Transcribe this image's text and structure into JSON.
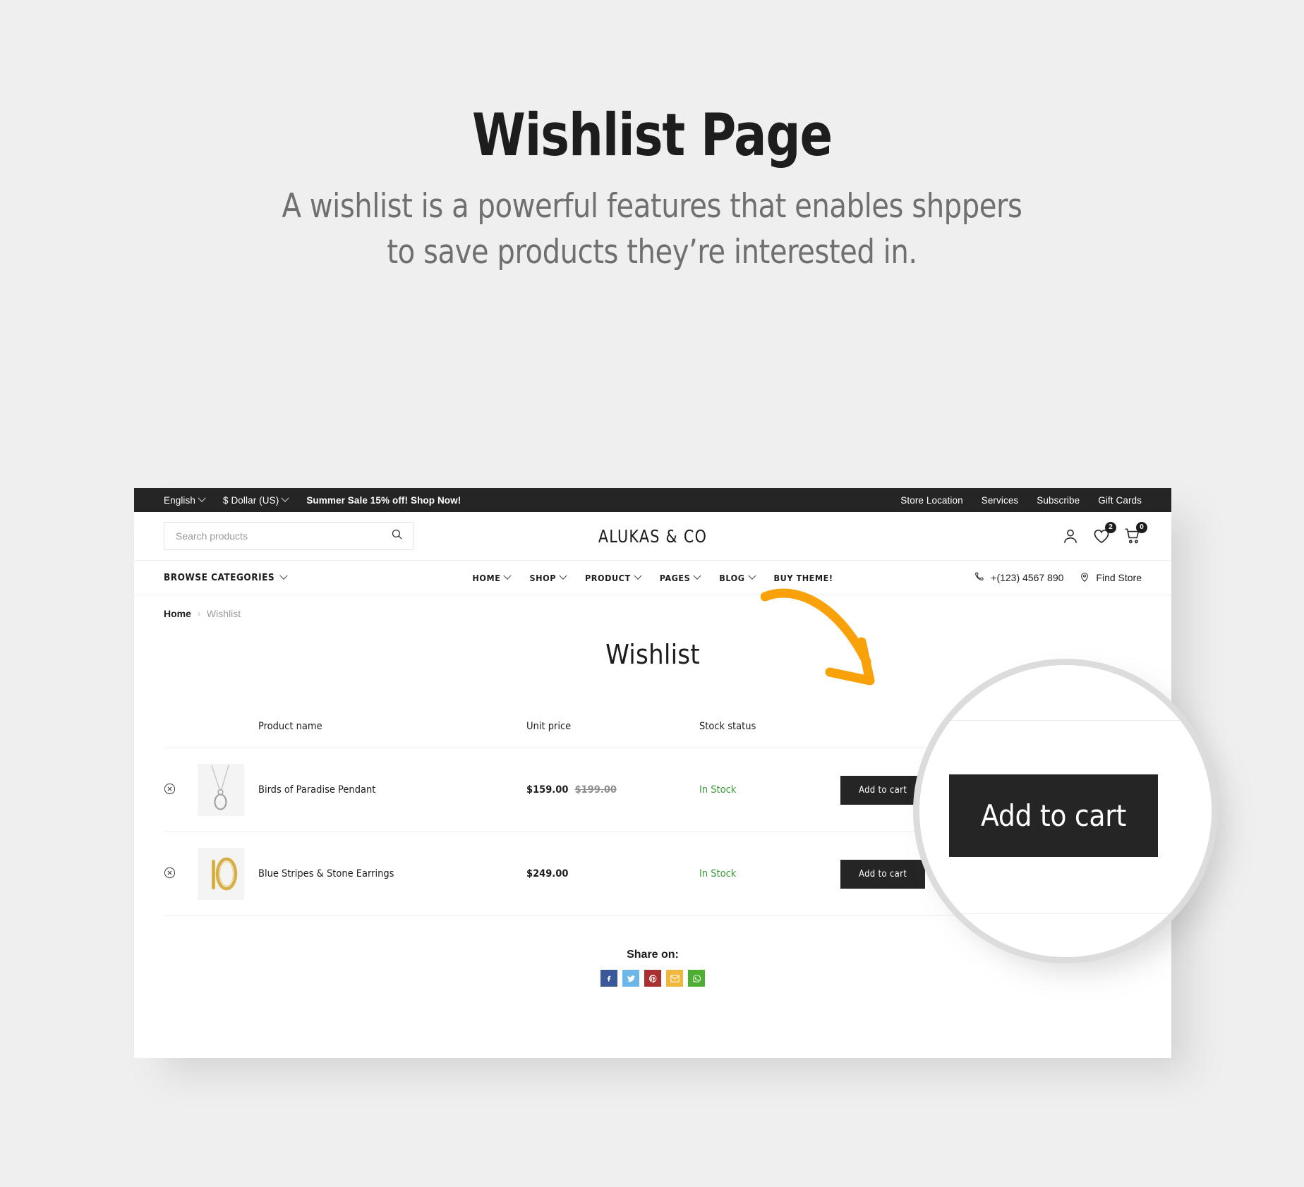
{
  "promo": {
    "title": "Wishlist Page",
    "subtitle_line1": "A wishlist is a powerful features that enables shppers",
    "subtitle_line2": "to save products they’re interested in."
  },
  "topbar": {
    "language": "English",
    "currency": "$ Dollar (US)",
    "promo_text": "Summer Sale 15% off! Shop Now!",
    "links": [
      "Store Location",
      "Services",
      "Subscribe",
      "Gift Cards"
    ]
  },
  "header": {
    "search_placeholder": "Search products",
    "search_value": "",
    "search_icon": "search-icon",
    "brand": "ALUKAS & CO",
    "account_icon": "user-icon",
    "wishlist_icon": "heart-icon",
    "wishlist_count": "2",
    "cart_icon": "cart-icon",
    "cart_count": "0"
  },
  "nav": {
    "browse_label": "BROWSE CATEGORIES",
    "menu": [
      {
        "label": "HOME",
        "caret": true
      },
      {
        "label": "SHOP",
        "caret": true
      },
      {
        "label": "PRODUCT",
        "caret": true
      },
      {
        "label": "PAGES",
        "caret": true
      },
      {
        "label": "BLOG",
        "caret": true
      },
      {
        "label": "BUY THEME!",
        "caret": false
      }
    ],
    "phone": "+(123) 4567 890",
    "phone_icon": "phone-icon",
    "find_store": "Find Store",
    "find_store_icon": "location-pin-icon"
  },
  "breadcrumb": {
    "home": "Home",
    "separator": "›",
    "current": "Wishlist"
  },
  "page": {
    "title": "Wishlist"
  },
  "table": {
    "headers": {
      "remove": "",
      "image": "",
      "product_name": "Product name",
      "unit_price": "Unit price",
      "stock_status": "Stock status",
      "action": ""
    },
    "rows": [
      {
        "remove_icon": "remove-circle-x-icon",
        "thumb": "necklace-pendant-thumbnail",
        "name": "Birds of Paradise Pendant",
        "price": "$159.00",
        "price_old": "$199.00",
        "stock": "In Stock",
        "action": "Add to cart"
      },
      {
        "remove_icon": "remove-circle-x-icon",
        "thumb": "gold-hoop-earrings-thumbnail",
        "name": "Blue Stripes & Stone Earrings",
        "price": "$249.00",
        "price_old": "",
        "stock": "In Stock",
        "action": "Add to cart"
      }
    ]
  },
  "share": {
    "label": "Share on:",
    "items": [
      {
        "name": "facebook",
        "color": "#3b5998",
        "glyph": "f"
      },
      {
        "name": "twitter",
        "color": "#6cb7e8",
        "glyph": "ᵛ"
      },
      {
        "name": "pinterest",
        "color": "#a93030",
        "glyph": "Ⓟ"
      },
      {
        "name": "email",
        "color": "#f0b73d",
        "glyph": "✉"
      },
      {
        "name": "whatsapp",
        "color": "#4caf32",
        "glyph": "☎"
      }
    ]
  },
  "magnifier": {
    "button_label": "Add to cart"
  },
  "colors": {
    "accent_orange": "#f9a109",
    "dark": "#252525",
    "in_stock_green": "#3a9a3a",
    "page_bg": "#efefef"
  }
}
